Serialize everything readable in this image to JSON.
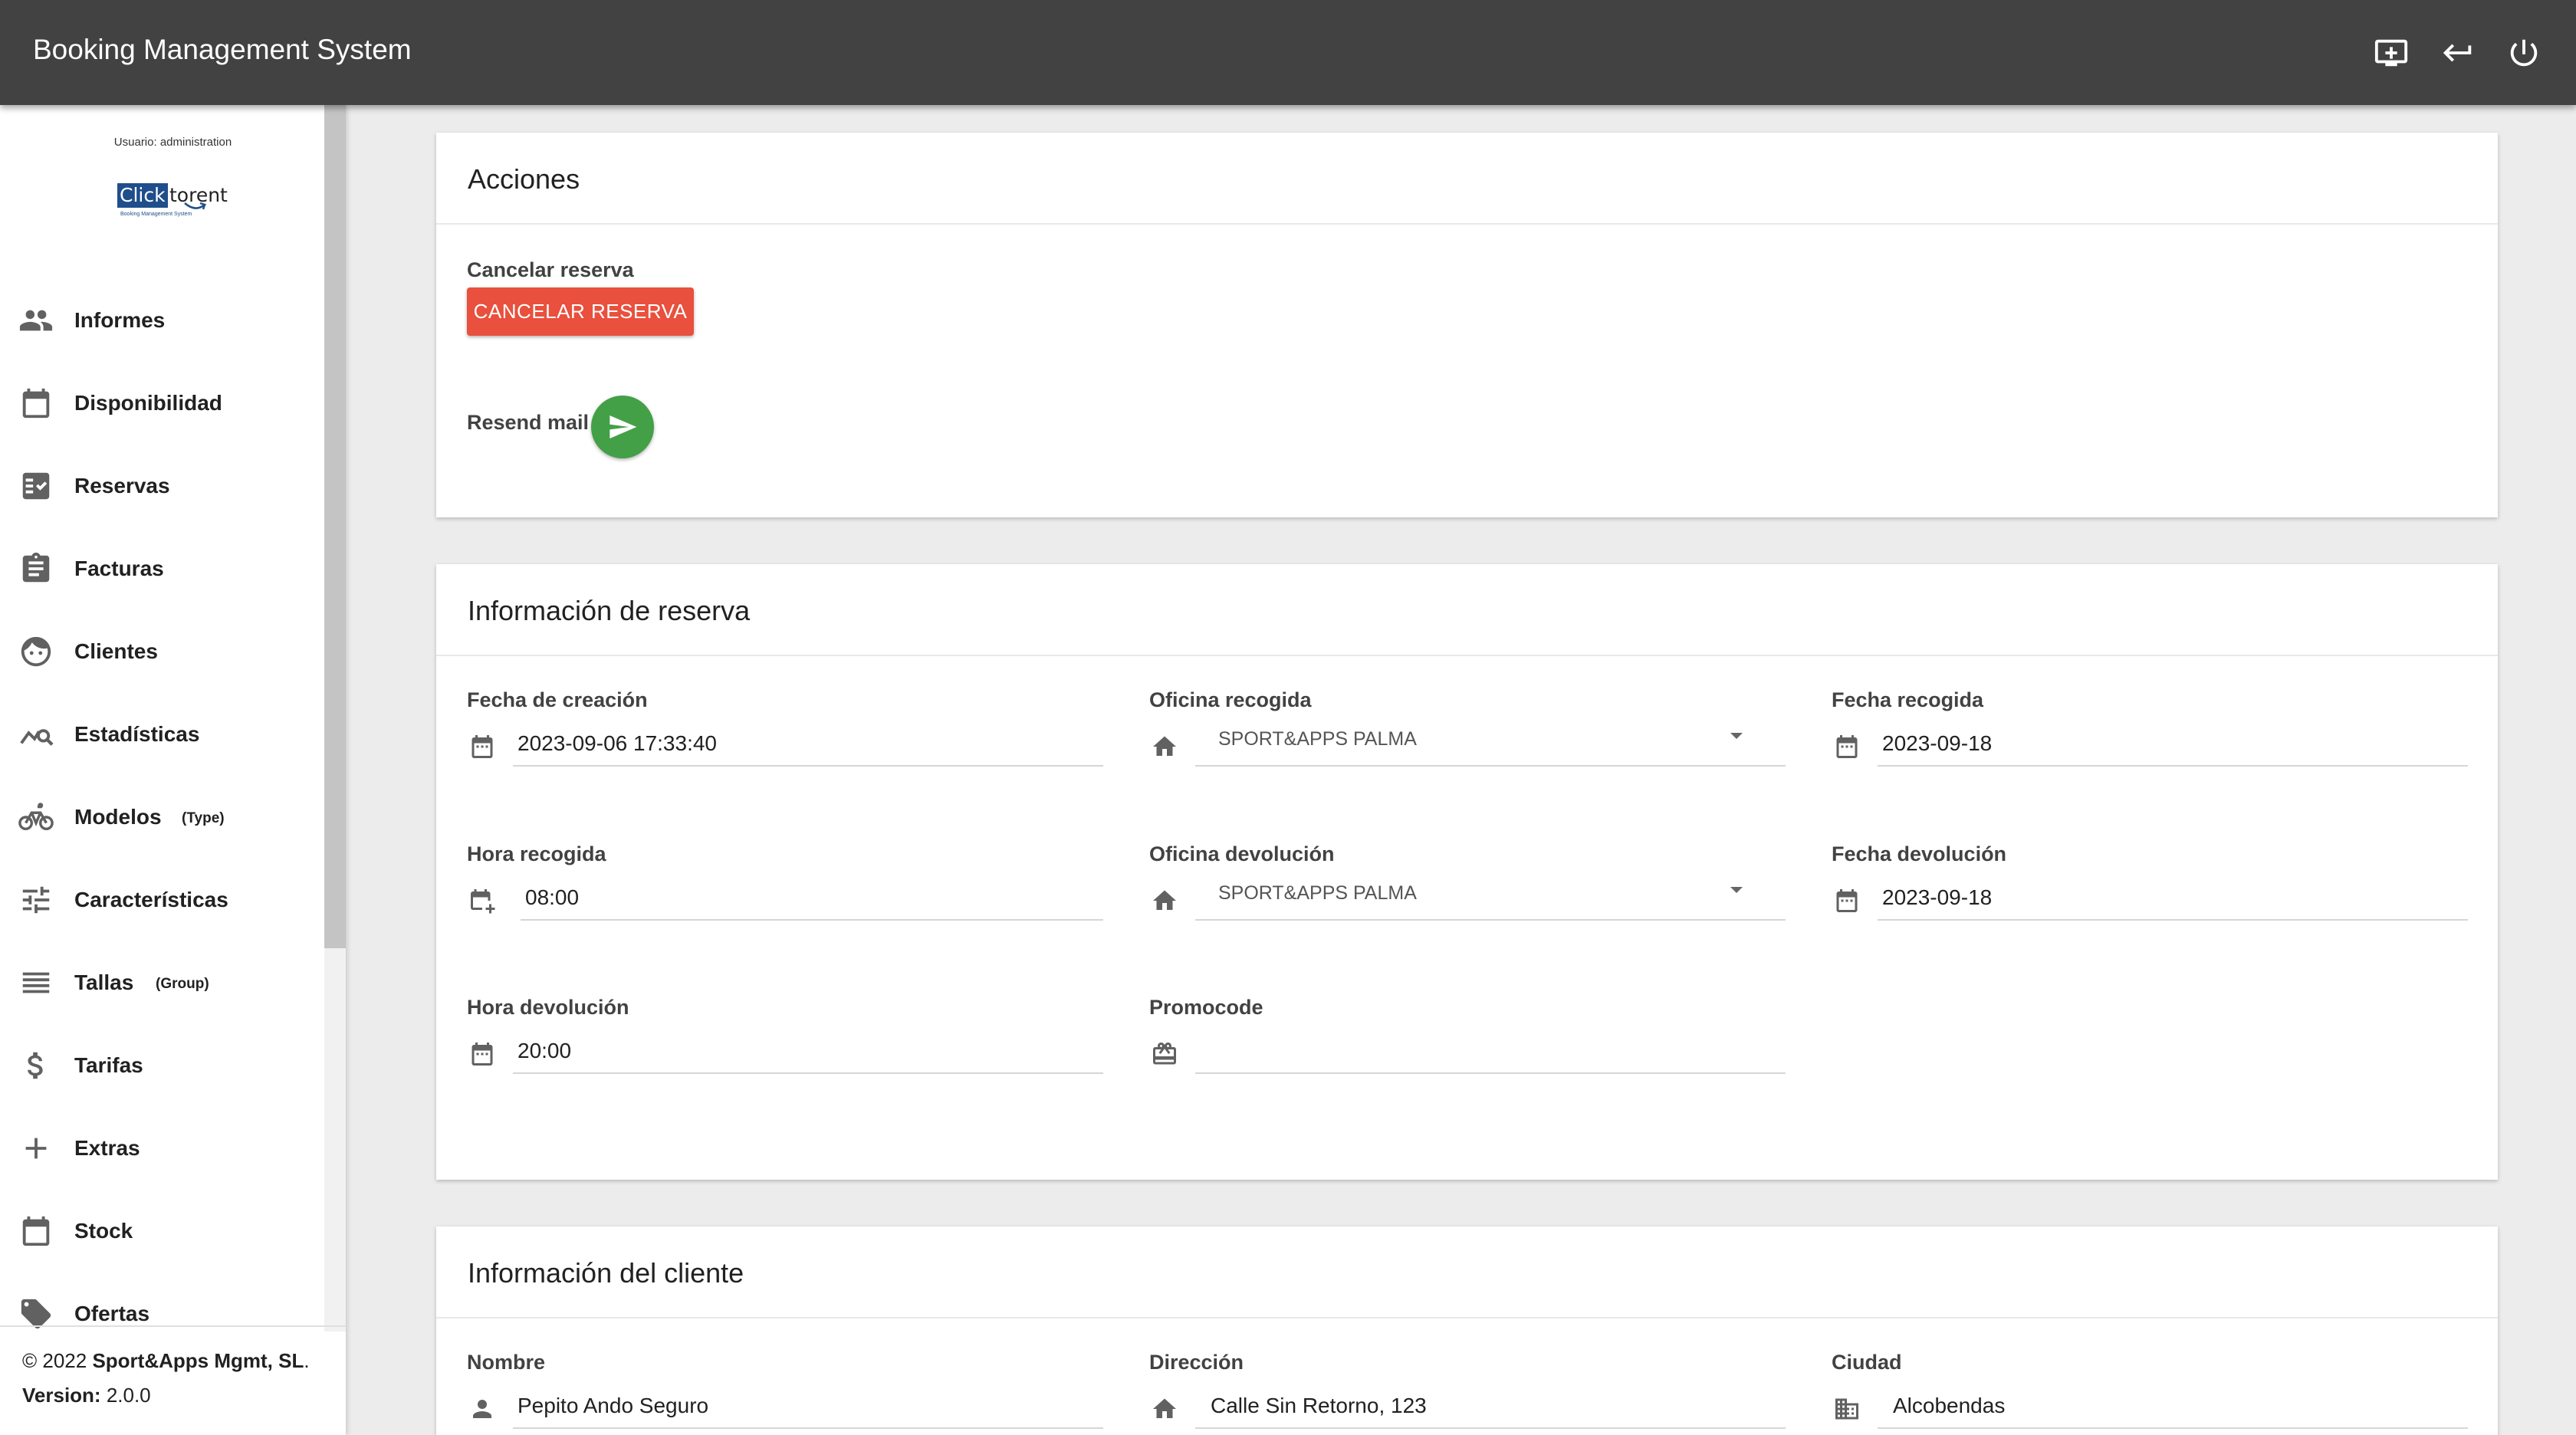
{
  "app": {
    "title": "Booking Management System"
  },
  "toolbar": {
    "icons": [
      "add-screen-icon",
      "return-icon",
      "power-icon"
    ]
  },
  "sidebar": {
    "user_label": "Usuario: administration",
    "logo": {
      "click": "Click",
      "torent": "torent",
      "subtitle": "Booking Management System"
    },
    "items": [
      {
        "label": "Informes",
        "icon": "people-icon"
      },
      {
        "label": "Disponibilidad",
        "icon": "calendar-icon"
      },
      {
        "label": "Reservas",
        "icon": "checklist-icon"
      },
      {
        "label": "Facturas",
        "icon": "clipboard-icon"
      },
      {
        "label": "Clientes",
        "icon": "face-icon"
      },
      {
        "label": "Estadísticas",
        "icon": "stats-icon"
      },
      {
        "label": "Modelos",
        "icon": "bike-icon",
        "tag": "(Type)"
      },
      {
        "label": "Características",
        "icon": "tune-icon"
      },
      {
        "label": "Tallas",
        "icon": "list-icon",
        "tag": "(Group)"
      },
      {
        "label": "Tarifas",
        "icon": "dollar-icon"
      },
      {
        "label": "Extras",
        "icon": "plus-icon"
      },
      {
        "label": "Stock",
        "icon": "calendar-icon"
      },
      {
        "label": "Ofertas",
        "icon": "tag-icon"
      }
    ],
    "footer": {
      "copyright_prefix": "© 2022 ",
      "company": "Sport&Apps Mgmt, SL",
      "copyright_suffix": ".",
      "version_label": "Version:",
      "version_value": " 2.0.0"
    }
  },
  "acciones": {
    "title": "Acciones",
    "cancel_heading": "Cancelar reserva",
    "cancel_button": "CANCELAR RESERVA",
    "resend_label": "Resend mail"
  },
  "reserva": {
    "title": "Información de reserva",
    "fecha_creacion": {
      "label": "Fecha de creación",
      "value": "2023-09-06 17:33:40"
    },
    "oficina_recogida": {
      "label": "Oficina recogida",
      "value": "SPORT&APPS PALMA"
    },
    "fecha_recogida": {
      "label": "Fecha recogida",
      "value": "2023-09-18"
    },
    "hora_recogida": {
      "label": "Hora recogida",
      "value": "08:00"
    },
    "oficina_devolucion": {
      "label": "Oficina devolución",
      "value": "SPORT&APPS PALMA"
    },
    "fecha_devolucion": {
      "label": "Fecha devolución",
      "value": "2023-09-18"
    },
    "hora_devolucion": {
      "label": "Hora devolución",
      "value": "20:00"
    },
    "promocode": {
      "label": "Promocode",
      "value": ""
    }
  },
  "cliente": {
    "title": "Información del cliente",
    "nombre": {
      "label": "Nombre",
      "value": "Pepito Ando Seguro"
    },
    "direccion": {
      "label": "Dirección",
      "value": "Calle Sin Retorno, 123"
    },
    "ciudad": {
      "label": "Ciudad",
      "value": "Alcobendas"
    }
  }
}
